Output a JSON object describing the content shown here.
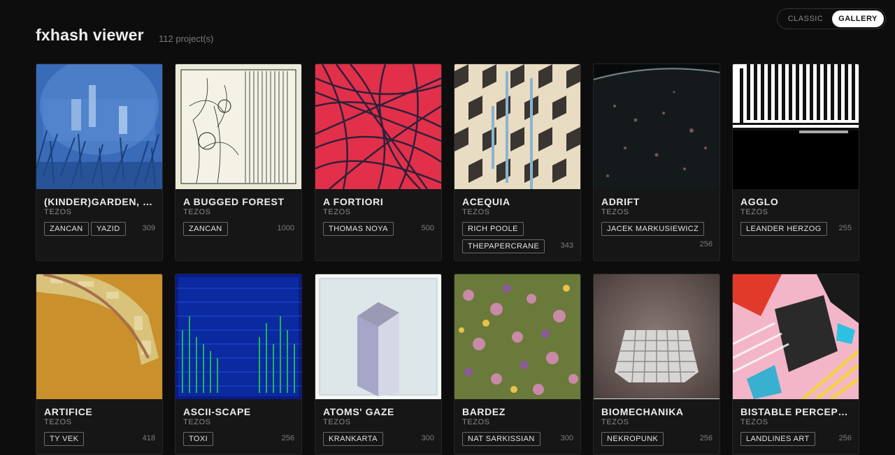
{
  "header": {
    "title": "fxhash viewer",
    "count": "112 project(s)"
  },
  "view_toggle": {
    "classic": "CLASSIC",
    "gallery": "GALLERY",
    "selected": "GALLERY"
  },
  "projects": [
    {
      "name": "(KINDER)GARDEN, M...",
      "chain": "TEZOS",
      "artists": [
        "ZANCAN",
        "YAZID"
      ],
      "editions": "309"
    },
    {
      "name": "A BUGGED FOREST",
      "chain": "TEZOS",
      "artists": [
        "ZANCAN"
      ],
      "editions": "1000"
    },
    {
      "name": "A FORTIORI",
      "chain": "TEZOS",
      "artists": [
        "THOMAS NOYA"
      ],
      "editions": "500"
    },
    {
      "name": "ACEQUIA",
      "chain": "TEZOS",
      "artists": [
        "RICH POOLE",
        "THEPAPERCRANE"
      ],
      "editions": "343"
    },
    {
      "name": "ADRIFT",
      "chain": "TEZOS",
      "artists": [
        "JACEK MARKUSIEWICZ"
      ],
      "editions": "256"
    },
    {
      "name": "AGGLO",
      "chain": "TEZOS",
      "artists": [
        "LEANDER HERZOG"
      ],
      "editions": "255"
    },
    {
      "name": "ARTIFICE",
      "chain": "TEZOS",
      "artists": [
        "TY VEK"
      ],
      "editions": "418"
    },
    {
      "name": "ASCII-SCAPE",
      "chain": "TEZOS",
      "artists": [
        "TOXI"
      ],
      "editions": "256"
    },
    {
      "name": "ATOMS' GAZE",
      "chain": "TEZOS",
      "artists": [
        "KRANKARTA"
      ],
      "editions": "300"
    },
    {
      "name": "BARDEZ",
      "chain": "TEZOS",
      "artists": [
        "NAT SARKISSIAN"
      ],
      "editions": "300"
    },
    {
      "name": "BIOMECHANIKA",
      "chain": "TEZOS",
      "artists": [
        "NEKROPUNK"
      ],
      "editions": "256"
    },
    {
      "name": "BISTABLE PERCEPTI...",
      "chain": "TEZOS",
      "artists": [
        "LANDLINES ART"
      ],
      "editions": "256"
    }
  ]
}
